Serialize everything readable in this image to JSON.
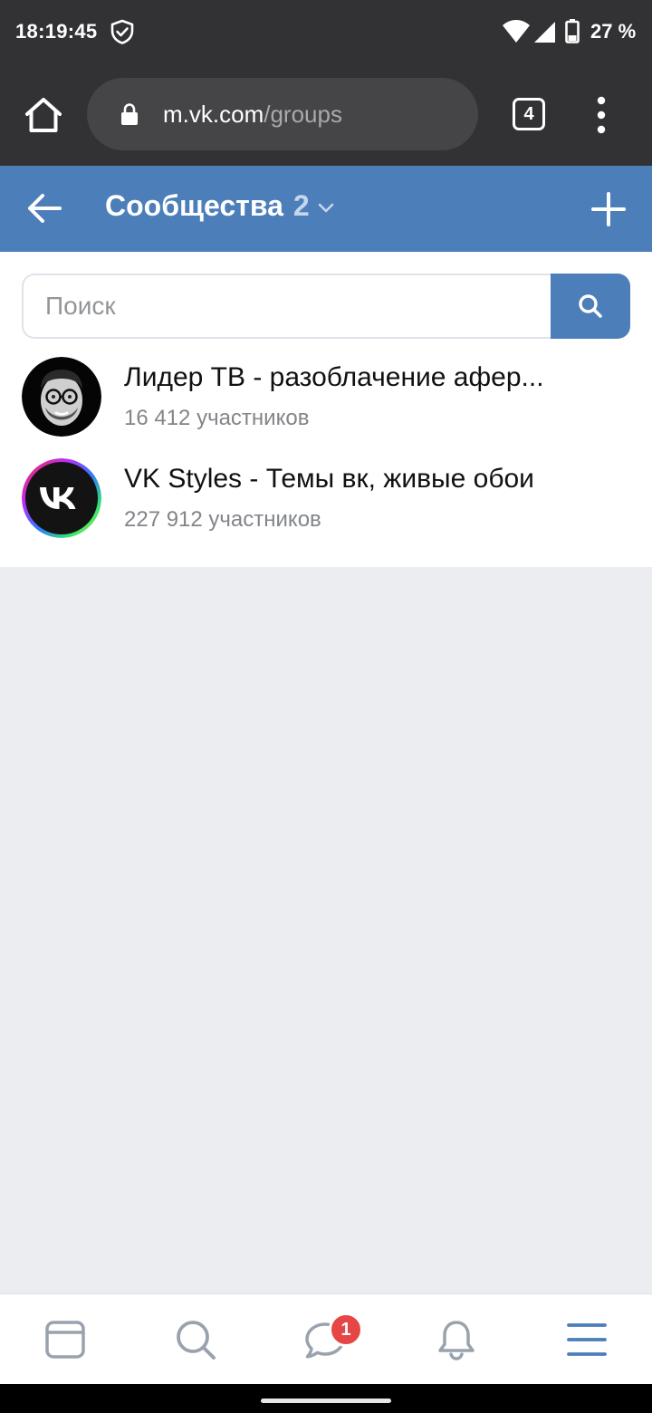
{
  "status_bar": {
    "time": "18:19:45",
    "battery": "27 %",
    "icons": [
      "shield-check-icon",
      "wifi-icon",
      "signal-icon",
      "battery-icon"
    ]
  },
  "browser": {
    "domain": "m.vk.com",
    "path": "/groups",
    "tab_count": "4",
    "icons": [
      "home-icon",
      "lock-icon",
      "more-vertical-icon"
    ]
  },
  "header": {
    "title": "Сообщества",
    "count": "2",
    "icons": [
      "back-arrow-icon",
      "chevron-down-icon",
      "plus-icon"
    ]
  },
  "search": {
    "placeholder": "Поиск",
    "value": ""
  },
  "groups": [
    {
      "name": "Лидер ТВ - разоблачение афер...",
      "members": "16 412 участников",
      "avatar": "photo-avatar"
    },
    {
      "name": "VK Styles - Темы вк, живые обои",
      "members": "227 912 участников",
      "avatar": "vk-logo-avatar"
    }
  ],
  "bottom_nav": {
    "items": [
      "news-icon",
      "search-icon",
      "messages-icon",
      "notifications-icon",
      "menu-icon"
    ],
    "messages_badge": "1"
  },
  "colors": {
    "vk_blue": "#4c7eb9",
    "chrome_dark": "#323234",
    "badge_red": "#e64646",
    "background": "#ebedf0"
  }
}
